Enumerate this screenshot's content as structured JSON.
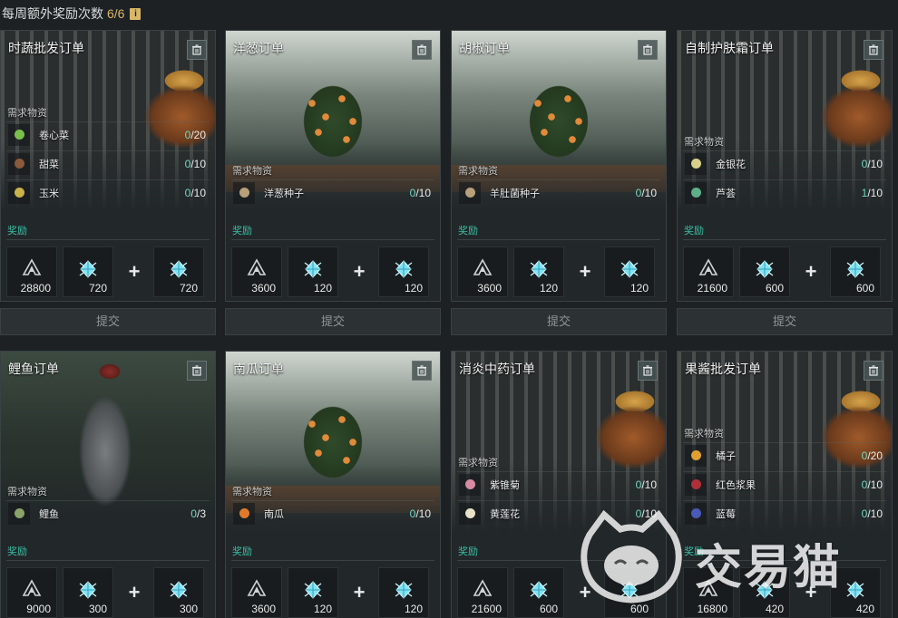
{
  "header": {
    "label": "每周额外奖励次数",
    "count": "6/6",
    "info_icon": "info-icon"
  },
  "labels": {
    "required": "需求物资",
    "reward": "奖励",
    "submit": "提交"
  },
  "watermark": {
    "text": "交易猫"
  },
  "colors": {
    "accent": "#3bbfa5",
    "gold": "#d9b768",
    "have": "#6fd7c5"
  },
  "orders": [
    {
      "title": "时蔬批发订单",
      "scene": "npc",
      "items": [
        {
          "name": "卷心菜",
          "have": "0",
          "need": "/20",
          "icon": "cabbage-icon",
          "color": "#7bbf4a"
        },
        {
          "name": "甜菜",
          "have": "0",
          "need": "/10",
          "icon": "beet-icon",
          "color": "#8a5a3a"
        },
        {
          "name": "玉米",
          "have": "0",
          "need": "/10",
          "icon": "corn-icon",
          "color": "#c9b24a"
        }
      ],
      "rewards": [
        "28800",
        "720",
        "720"
      ],
      "submit": true
    },
    {
      "title": "洋葱订单",
      "scene": "plant",
      "items": [
        {
          "name": "洋葱种子",
          "have": "0",
          "need": "/10",
          "icon": "seed-bag-icon",
          "color": "#b8a07a"
        }
      ],
      "rewards": [
        "3600",
        "120",
        "120"
      ],
      "submit": true
    },
    {
      "title": "胡椒订单",
      "scene": "plant",
      "items": [
        {
          "name": "羊肚菌种子",
          "have": "0",
          "need": "/10",
          "icon": "seed-bag-icon",
          "color": "#b8a07a"
        }
      ],
      "rewards": [
        "3600",
        "120",
        "120"
      ],
      "submit": true
    },
    {
      "title": "自制护肤霜订单",
      "scene": "npc",
      "items": [
        {
          "name": "金银花",
          "have": "0",
          "need": "/10",
          "icon": "honeysuckle-icon",
          "color": "#d8d08a"
        },
        {
          "name": "芦荟",
          "have": "1",
          "need": "/10",
          "icon": "aloe-icon",
          "color": "#5fae8a"
        }
      ],
      "rewards": [
        "21600",
        "600",
        "600"
      ],
      "submit": true
    },
    {
      "title": "鲤鱼订单",
      "scene": "soldier",
      "items": [
        {
          "name": "鲤鱼",
          "have": "0",
          "need": "/3",
          "icon": "carp-icon",
          "color": "#8aa36a"
        }
      ],
      "rewards": [
        "9000",
        "300",
        "300"
      ],
      "submit": false
    },
    {
      "title": "南瓜订单",
      "scene": "plant",
      "items": [
        {
          "name": "南瓜",
          "have": "0",
          "need": "/10",
          "icon": "pumpkin-icon",
          "color": "#e07a2a"
        }
      ],
      "rewards": [
        "3600",
        "120",
        "120"
      ],
      "submit": false
    },
    {
      "title": "消炎中药订单",
      "scene": "npc",
      "items": [
        {
          "name": "紫锥菊",
          "have": "0",
          "need": "/10",
          "icon": "echinacea-icon",
          "color": "#d88aa0"
        },
        {
          "name": "黄莲花",
          "have": "0",
          "need": "/10",
          "icon": "lotus-icon",
          "color": "#e8e2c8"
        }
      ],
      "rewards": [
        "21600",
        "600",
        "600"
      ],
      "submit": false
    },
    {
      "title": "果酱批发订单",
      "scene": "npc",
      "items": [
        {
          "name": "橘子",
          "have": "0",
          "need": "/20",
          "icon": "orange-icon",
          "color": "#e0a030"
        },
        {
          "name": "红色浆果",
          "have": "0",
          "need": "/10",
          "icon": "red-berry-icon",
          "color": "#b0303a"
        },
        {
          "name": "蓝莓",
          "have": "0",
          "need": "/10",
          "icon": "blueberry-icon",
          "color": "#4a5ab8"
        }
      ],
      "rewards": [
        "16800",
        "420",
        "420"
      ],
      "submit": false
    }
  ]
}
